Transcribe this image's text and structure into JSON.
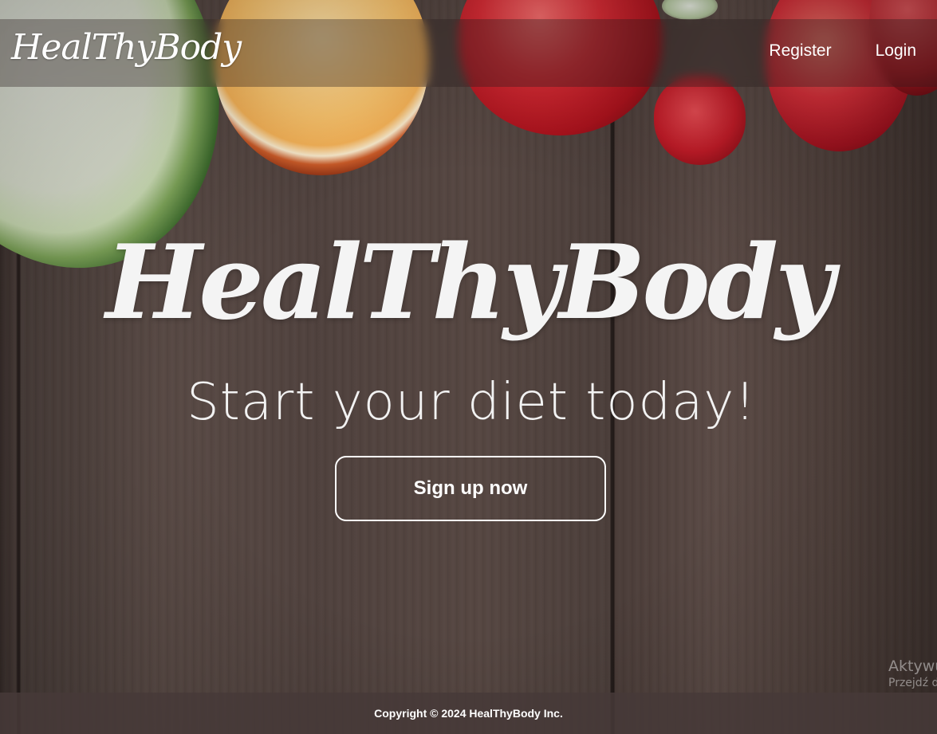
{
  "navbar": {
    "brand": "HealThyBody",
    "links": [
      "Register",
      "Login"
    ]
  },
  "hero": {
    "title": "HealThyBody",
    "subtitle": "Start your diet today!",
    "cta_label": "Sign up now"
  },
  "watermark": {
    "line1": "Aktywu",
    "line2": "Przejdź d"
  },
  "footer": {
    "copyright": "Copyright © 2024 HealThyBody Inc."
  },
  "colors": {
    "text": "#ffffff",
    "wood": "#4a3c38"
  }
}
